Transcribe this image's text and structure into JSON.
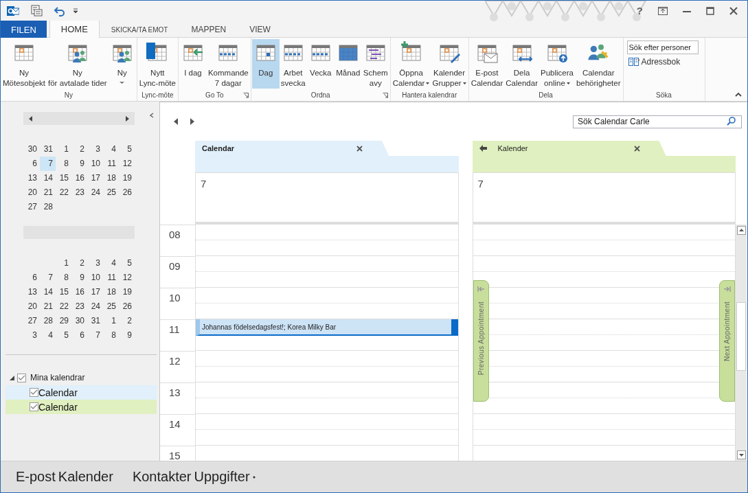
{
  "title_bar": {
    "help": "?"
  },
  "tabs": [
    {
      "label": "FILEN",
      "kind": "file",
      "selected": false
    },
    {
      "label": "HOME",
      "kind": "tab",
      "selected": true
    },
    {
      "label": "SKICKA/TA EMOT",
      "kind": "tab",
      "selected": false
    },
    {
      "label": "MAPPEN",
      "kind": "tab",
      "selected": false
    },
    {
      "label": "VIEW",
      "kind": "tab",
      "selected": false
    }
  ],
  "ribbon": {
    "groups": [
      {
        "label": "Ny",
        "launcher": false,
        "buttons": [
          {
            "lines": [
              "Ny",
              "Mötesobjekt"
            ],
            "selected": false,
            "dropdown": false
          },
          {
            "lines": [
              "Ny",
              "för avtalade tider"
            ],
            "selected": false,
            "dropdown": false
          },
          {
            "lines": [
              "Ny"
            ],
            "selected": false,
            "dropdown": true
          }
        ]
      },
      {
        "label": "Lync-möte",
        "launcher": false,
        "buttons": [
          {
            "lines": [
              "Nytt",
              "Lync-möte"
            ],
            "selected": false,
            "dropdown": false
          }
        ]
      },
      {
        "label": "Go To",
        "launcher": true,
        "buttons": [
          {
            "lines": [
              "I dag"
            ],
            "selected": false,
            "dropdown": false
          },
          {
            "lines": [
              "Kommande",
              "7 dagar"
            ],
            "selected": false,
            "dropdown": false
          }
        ]
      },
      {
        "label": "Ordna",
        "launcher": true,
        "buttons": [
          {
            "lines": [
              "Dag"
            ],
            "selected": true,
            "dropdown": false
          },
          {
            "lines": [
              "Arbet",
              "svecka"
            ],
            "selected": false,
            "dropdown": false
          },
          {
            "lines": [
              "Vecka"
            ],
            "selected": false,
            "dropdown": false
          },
          {
            "lines": [
              "Månad"
            ],
            "selected": false,
            "dropdown": false
          },
          {
            "lines": [
              "Schem",
              "avy"
            ],
            "selected": false,
            "dropdown": false
          }
        ]
      },
      {
        "label": "Hantera kalendrar",
        "launcher": false,
        "buttons": [
          {
            "lines": [
              "Öppna",
              "Calendar"
            ],
            "selected": false,
            "dropdown": true
          },
          {
            "lines": [
              "Kalender",
              "Grupper"
            ],
            "selected": false,
            "dropdown": true
          }
        ]
      },
      {
        "label": "Dela",
        "launcher": false,
        "buttons": [
          {
            "lines": [
              "E-post",
              "Calendar"
            ],
            "selected": false,
            "dropdown": false
          },
          {
            "lines": [
              "Dela",
              "Calendar"
            ],
            "selected": false,
            "dropdown": false
          },
          {
            "lines": [
              "Publicera",
              "online"
            ],
            "selected": false,
            "dropdown": true
          },
          {
            "lines": [
              "Calendar",
              "behörigheter"
            ],
            "selected": false,
            "dropdown": false
          }
        ]
      }
    ],
    "search": {
      "label": "Söka",
      "field": {
        "placeholder": "Sök efter personer"
      },
      "address_book": "Adressbok"
    }
  },
  "navigation": {
    "months": [
      {
        "weeks": [
          {
            "days": [
              {
                "n": "30",
                "selected": false
              },
              {
                "n": "31",
                "selected": false
              },
              {
                "n": "1",
                "selected": false
              },
              {
                "n": "2",
                "selected": false
              },
              {
                "n": "3",
                "selected": false
              },
              {
                "n": "4",
                "selected": false
              },
              {
                "n": "5",
                "selected": false
              }
            ]
          },
          {
            "days": [
              {
                "n": "6",
                "selected": false
              },
              {
                "n": "7",
                "selected": true
              },
              {
                "n": "8",
                "selected": false
              },
              {
                "n": "9",
                "selected": false
              },
              {
                "n": "10",
                "selected": false
              },
              {
                "n": "11",
                "selected": false
              },
              {
                "n": "12",
                "selected": false
              }
            ]
          },
          {
            "days": [
              {
                "n": "13",
                "selected": false
              },
              {
                "n": "14",
                "selected": false
              },
              {
                "n": "15",
                "selected": false
              },
              {
                "n": "16",
                "selected": false
              },
              {
                "n": "17",
                "selected": false
              },
              {
                "n": "18",
                "selected": false
              },
              {
                "n": "19",
                "selected": false
              }
            ]
          },
          {
            "days": [
              {
                "n": "20",
                "selected": false
              },
              {
                "n": "21",
                "selected": false
              },
              {
                "n": "22",
                "selected": false
              },
              {
                "n": "23",
                "selected": false
              },
              {
                "n": "24",
                "selected": false
              },
              {
                "n": "25",
                "selected": false
              },
              {
                "n": "26",
                "selected": false
              }
            ]
          },
          {
            "days": [
              {
                "n": "27",
                "selected": false
              },
              {
                "n": "28",
                "selected": false
              }
            ]
          }
        ]
      },
      {
        "weeks": [
          {
            "days": [
              {
                "n": "1",
                "selected": false
              },
              {
                "n": "2",
                "selected": false
              },
              {
                "n": "3",
                "selected": false
              },
              {
                "n": "4",
                "selected": false
              },
              {
                "n": "5",
                "selected": false
              }
            ]
          },
          {
            "days": [
              {
                "n": "6",
                "selected": false
              },
              {
                "n": "7",
                "selected": false
              },
              {
                "n": "8",
                "selected": false
              },
              {
                "n": "9",
                "selected": false
              },
              {
                "n": "10",
                "selected": false
              },
              {
                "n": "11",
                "selected": false
              },
              {
                "n": "12",
                "selected": false
              }
            ]
          },
          {
            "days": [
              {
                "n": "13",
                "selected": false
              },
              {
                "n": "14",
                "selected": false
              },
              {
                "n": "15",
                "selected": false
              },
              {
                "n": "16",
                "selected": false
              },
              {
                "n": "17",
                "selected": false
              },
              {
                "n": "18",
                "selected": false
              },
              {
                "n": "19",
                "selected": false
              }
            ]
          },
          {
            "days": [
              {
                "n": "20",
                "selected": false
              },
              {
                "n": "21",
                "selected": false
              },
              {
                "n": "22",
                "selected": false
              },
              {
                "n": "23",
                "selected": false
              },
              {
                "n": "24",
                "selected": false
              },
              {
                "n": "25",
                "selected": false
              },
              {
                "n": "26",
                "selected": false
              }
            ]
          },
          {
            "days": [
              {
                "n": "27",
                "selected": false
              },
              {
                "n": "28",
                "selected": false
              },
              {
                "n": "29",
                "selected": false
              },
              {
                "n": "30",
                "selected": false
              },
              {
                "n": "31",
                "selected": false
              },
              {
                "n": "1",
                "selected": false
              },
              {
                "n": "2",
                "selected": false
              }
            ]
          },
          {
            "days": [
              {
                "n": "3",
                "selected": false
              },
              {
                "n": "4",
                "selected": false
              },
              {
                "n": "5",
                "selected": false
              },
              {
                "n": "6",
                "selected": false
              },
              {
                "n": "7",
                "selected": false
              },
              {
                "n": "8",
                "selected": false
              },
              {
                "n": "9",
                "selected": false
              }
            ]
          }
        ]
      }
    ],
    "folders": [
      {
        "label": "Mina kalendrar",
        "checked": true,
        "expanded": true,
        "children": [
          {
            "label": "Calendar",
            "checked": true,
            "color": "#e1f0fa"
          },
          {
            "label": "Calendar",
            "checked": true,
            "color": "#e0f0c0"
          }
        ]
      }
    ]
  },
  "calendar_view": {
    "search": {
      "placeholder": "Sök Calendar Carle"
    },
    "rows": [
      {
        "hour": "08"
      },
      {
        "hour": "09"
      },
      {
        "hour": "10"
      },
      {
        "hour": "11",
        "event": "Johannas födelsedagsfest!; Korea Milky Bar"
      },
      {
        "hour": "12"
      },
      {
        "hour": "13"
      },
      {
        "hour": "14"
      },
      {
        "hour": "15"
      }
    ],
    "columns": [
      {
        "title": "Calendar",
        "bold": true,
        "back_arrow": false,
        "color": "#e1f0fa",
        "day": "7"
      },
      {
        "title": "Kalender",
        "bold": false,
        "back_arrow": true,
        "color": "#e0f0c0",
        "day": "7",
        "nav_tabs": [
          {
            "label": "Previous Appointment",
            "kind": "previous"
          },
          {
            "label": "Next Appointment",
            "kind": "next"
          }
        ]
      }
    ]
  },
  "bottom_nav": [
    "E-post",
    "Kalender",
    "Kontakter",
    "Uppgifter"
  ]
}
